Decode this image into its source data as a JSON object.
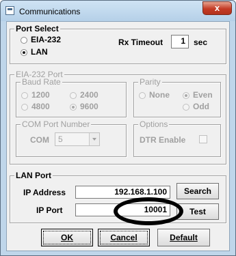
{
  "window": {
    "title": "Communications",
    "close_glyph": "x"
  },
  "port_select": {
    "legend": "Port Select",
    "options": [
      {
        "label": "EIA-232",
        "selected": false
      },
      {
        "label": "LAN",
        "selected": true
      }
    ],
    "rx_timeout": {
      "label": "Rx Timeout",
      "value": "1",
      "unit": "sec"
    }
  },
  "eia232": {
    "legend": "EIA-232 Port",
    "baud_rate": {
      "legend": "Baud Rate",
      "options": [
        {
          "label": "1200",
          "selected": false
        },
        {
          "label": "2400",
          "selected": false
        },
        {
          "label": "4800",
          "selected": false
        },
        {
          "label": "9600",
          "selected": true
        }
      ]
    },
    "parity": {
      "legend": "Parity",
      "options": [
        {
          "label": "None",
          "selected": false
        },
        {
          "label": "Even",
          "selected": true
        },
        {
          "label": "Odd",
          "selected": false
        }
      ]
    },
    "com_port": {
      "legend": "COM Port Number",
      "label": "COM",
      "value": "5"
    },
    "options_group": {
      "legend": "Options",
      "dtr_label": "DTR Enable",
      "dtr_checked": false
    }
  },
  "lan_port": {
    "legend": "LAN Port",
    "ip_address": {
      "label": "IP Address",
      "value": "192.168.1.100"
    },
    "ip_port": {
      "label": "IP Port",
      "value": "10001"
    },
    "search_label": "Search",
    "test_label": "Test"
  },
  "buttons": {
    "ok": "OK",
    "cancel": "Cancel",
    "default": "Default"
  },
  "colors": {
    "title_bar": "#bfd6ea",
    "close_button": "#c43b25",
    "disabled_text": "#a0a0a0",
    "annotation": "#000000"
  }
}
